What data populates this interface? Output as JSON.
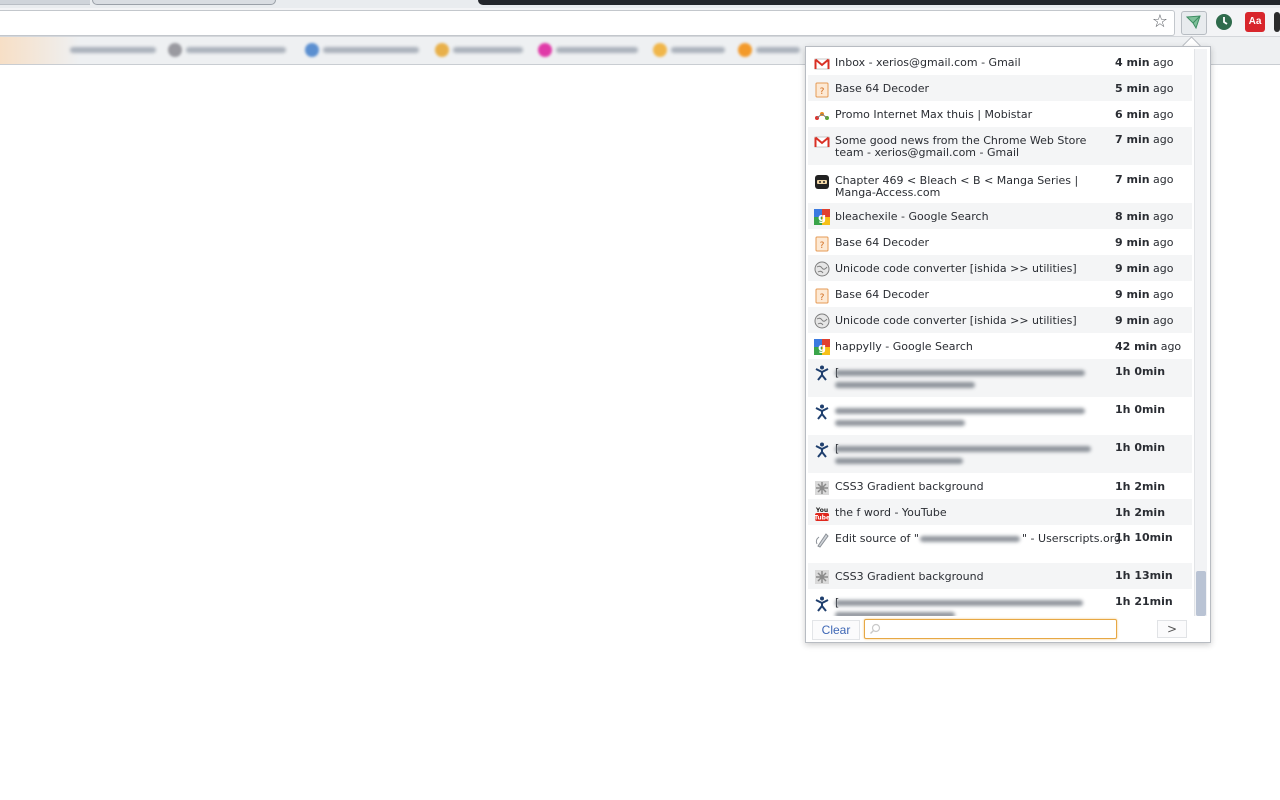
{
  "popup": {
    "items": [
      {
        "title": "Inbox - xerios@gmail.com - Gmail",
        "time_num": "4 min",
        "time_unit": "ago",
        "icon": "gmail-icon"
      },
      {
        "title": "Base 64 Decoder",
        "time_num": "5 min",
        "time_unit": "ago",
        "icon": "base64-decoder-icon"
      },
      {
        "title": "Promo Internet Max thuis | Mobistar",
        "time_num": "6 min",
        "time_unit": "ago",
        "icon": "mobistar-icon"
      },
      {
        "title": "Some good news from the Chrome Web Store team - xerios@gmail.com - Gmail",
        "time_num": "7 min",
        "time_unit": "ago",
        "icon": "gmail-icon"
      },
      {
        "title": "Chapter 469 < Bleach < B < Manga Series | Manga-Access.com",
        "time_num": "7 min",
        "time_unit": "ago",
        "icon": "manga-access-icon"
      },
      {
        "title": "bleachexile - Google Search",
        "time_num": "8 min",
        "time_unit": "ago",
        "icon": "google-icon"
      },
      {
        "title": "Base 64 Decoder",
        "time_num": "9 min",
        "time_unit": "ago",
        "icon": "base64-decoder-icon"
      },
      {
        "title": "Unicode code converter [ishida >> utilities]",
        "time_num": "9 min",
        "time_unit": "ago",
        "icon": "globe-icon"
      },
      {
        "title": "Base 64 Decoder",
        "time_num": "9 min",
        "time_unit": "ago",
        "icon": "base64-decoder-icon"
      },
      {
        "title": "Unicode code converter [ishida >> utilities]",
        "time_num": "9 min",
        "time_unit": "ago",
        "icon": "globe-icon"
      },
      {
        "title": "happylly - Google Search",
        "time_num": "42 min",
        "time_unit": "ago",
        "icon": "google-icon"
      },
      {
        "title": "[",
        "time_num": "1h 0min",
        "time_unit": "",
        "icon": "stickman-icon"
      },
      {
        "title": "",
        "time_num": "1h 0min",
        "time_unit": "",
        "icon": "stickman-icon"
      },
      {
        "title": "[",
        "time_num": "1h 0min",
        "time_unit": "",
        "icon": "stickman-icon"
      },
      {
        "title": "CSS3 Gradient background",
        "time_num": "1h 2min",
        "time_unit": "",
        "icon": "css3-icon"
      },
      {
        "title": "the f word - YouTube",
        "time_num": "1h 2min",
        "time_unit": "",
        "icon": "youtube-icon"
      },
      {
        "title": "Edit source of \"",
        "title_end": "\" - Userscripts.org",
        "time_num": "1h 10min",
        "time_unit": "",
        "icon": "userscripts-icon"
      },
      {
        "title": "CSS3 Gradient background",
        "time_num": "1h 13min",
        "time_unit": "",
        "icon": "css3-icon"
      },
      {
        "title": "[",
        "time_num": "1h 21min",
        "time_unit": "",
        "icon": "stickman-icon"
      }
    ],
    "footer": {
      "clear_label": "Clear",
      "search_placeholder": "",
      "next_label": ">"
    }
  },
  "toolbar": {
    "dictionary_ext_label": "Aa"
  },
  "colors": {
    "search_focus": "#e7a844",
    "clear_link": "#3e67b5",
    "scroll_thumb": "#b9c3d4"
  }
}
